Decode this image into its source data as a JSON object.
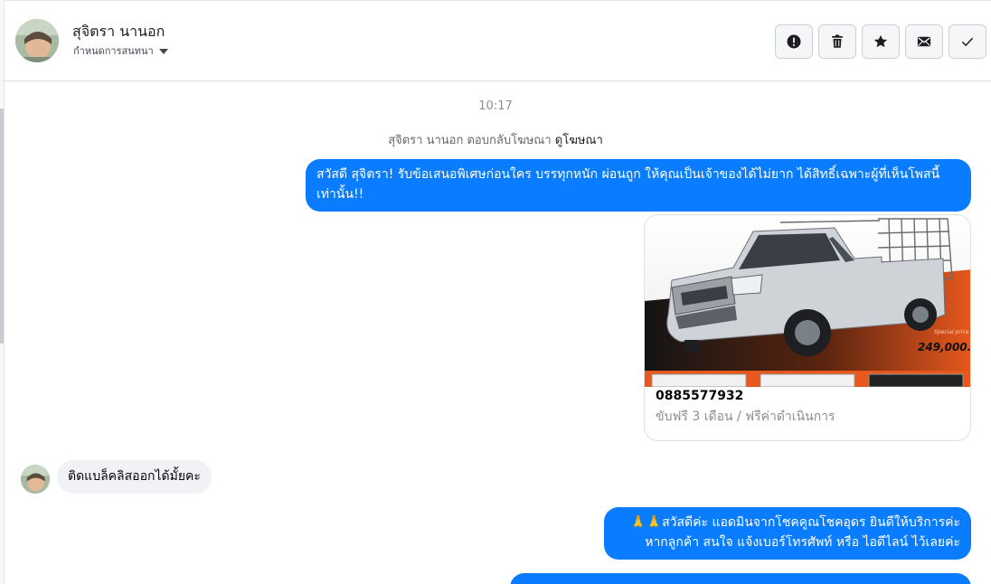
{
  "header": {
    "contact_name": "สุจิตรา นานอก",
    "label_selector": "กำหนดการสนทนา",
    "actions": [
      {
        "name": "report-button",
        "icon": "exclamation-circle-icon"
      },
      {
        "name": "delete-button",
        "icon": "trash-icon"
      },
      {
        "name": "star-button",
        "icon": "star-icon"
      },
      {
        "name": "mark-unread-button",
        "icon": "envelope-icon"
      },
      {
        "name": "mark-done-button",
        "icon": "checkmark-icon"
      }
    ]
  },
  "thread": {
    "timestamp": "10:17",
    "reply_note": "สุจิตรา นานอก ตอบกลับโฆษณา",
    "view_ad_link": "ดูโฆษณา",
    "messages": [
      {
        "direction": "out",
        "text": "สวัสดี สุจิตรา! รับข้อเสนอพิเศษก่อนใคร บรรทุกหนัก ผ่อนถูก ให้คุณเป็นเจ้าของได้ไม่ยาก ได้สิทธิ์เฉพาะผู้ที่เห็นโพสนี้เท่านั้น!!"
      },
      {
        "direction": "out",
        "type": "ad-card",
        "title": "0885577932",
        "subtitle": "ขับฟรี 3 เดือน / ฟรีค่าดำเนินการ",
        "price_text": "249,000.-",
        "special_text": "Special price"
      },
      {
        "direction": "in",
        "text": "ติดแบล็คลิสออกได้มั้ยคะ"
      },
      {
        "direction": "out",
        "text": "🙏🙏สวัสดีค่ะ แอดมินจากโชคคูณโชคอุดร ยินดีให้บริการค่ะ หากลูกค้า สนใจ แจ้งเบอร์โทรศัพท์ หรือ ไอดีไลน์  ไว้เลยค่ะ"
      }
    ]
  },
  "colors": {
    "outgoing_bubble": "#0a7cff",
    "incoming_bubble": "#f0f2f5",
    "accent_orange": "#e8581c"
  }
}
